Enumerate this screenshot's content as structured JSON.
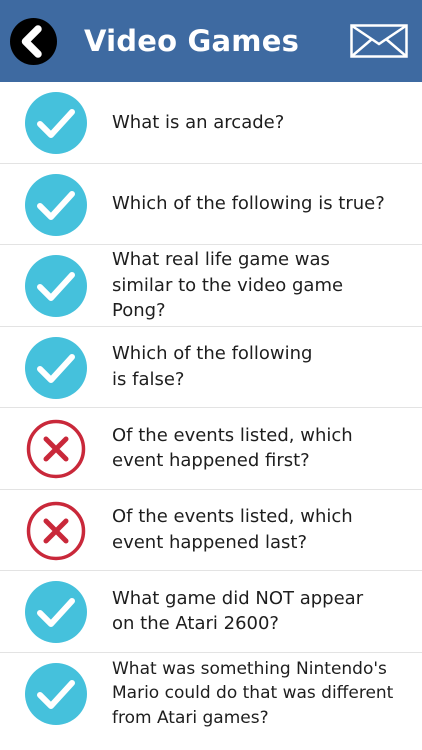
{
  "header": {
    "title": "Video Games",
    "bg_color": "#3e6aa1"
  },
  "questions": [
    {
      "text": "What is an arcade?",
      "status": "correct",
      "icon": "check-circle-icon"
    },
    {
      "text": "Which of the following is true?",
      "status": "correct",
      "icon": "check-circle-icon"
    },
    {
      "text": "What real life game was similar to the video game Pong?",
      "status": "correct",
      "icon": "check-circle-icon"
    },
    {
      "text": "Which of the following is false?",
      "status": "correct",
      "icon": "check-circle-icon"
    },
    {
      "text": "Of the events listed, which event happened first?",
      "status": "incorrect",
      "icon": "x-circle-icon"
    },
    {
      "text": "Of the events listed, which event happened last?",
      "status": "incorrect",
      "icon": "x-circle-icon"
    },
    {
      "text": "What game did NOT appear on the Atari 2600?",
      "status": "correct",
      "icon": "check-circle-icon"
    },
    {
      "text": "What was something Nintendo's Mario could do that was different from Atari games?",
      "status": "correct",
      "icon": "check-circle-icon"
    }
  ],
  "colors": {
    "correct": "#45c1dc",
    "incorrect": "#c9283a"
  }
}
